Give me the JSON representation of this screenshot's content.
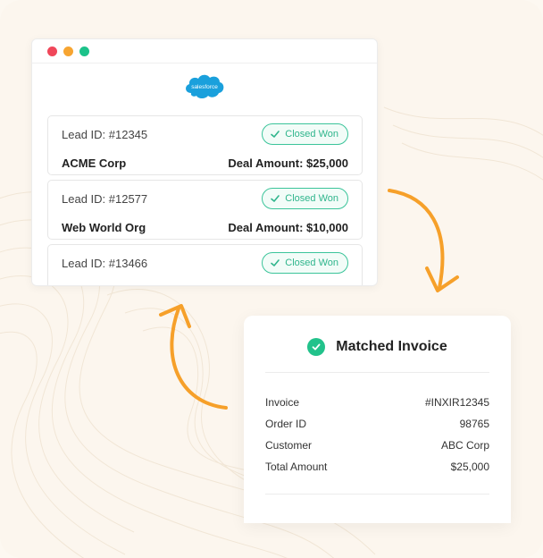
{
  "colors": {
    "accent_orange": "#f6a02a",
    "success_green": "#22c28b",
    "badge_green": "#2fb58c"
  },
  "window": {
    "controls": [
      "close-dot",
      "minimize-dot",
      "maximize-dot"
    ],
    "logo_text": "salesforce"
  },
  "leads": [
    {
      "id_label": "Lead ID: #12345",
      "status": "Closed Won",
      "company": "ACME Corp",
      "deal": "Deal Amount: $25,000"
    },
    {
      "id_label": "Lead ID: #12577",
      "status": "Closed Won",
      "company": "Web World Org",
      "deal": "Deal Amount: $10,000"
    },
    {
      "id_label": "Lead ID: #13466",
      "status": "Closed Won",
      "company": "",
      "deal": ""
    }
  ],
  "invoice": {
    "title": "Matched Invoice",
    "rows": [
      {
        "label": "Invoice",
        "value": "#INXIR12345"
      },
      {
        "label": "Order ID",
        "value": "98765"
      },
      {
        "label": "Customer",
        "value": "ABC Corp"
      },
      {
        "label": "Total Amount",
        "value": "$25,000"
      }
    ]
  }
}
